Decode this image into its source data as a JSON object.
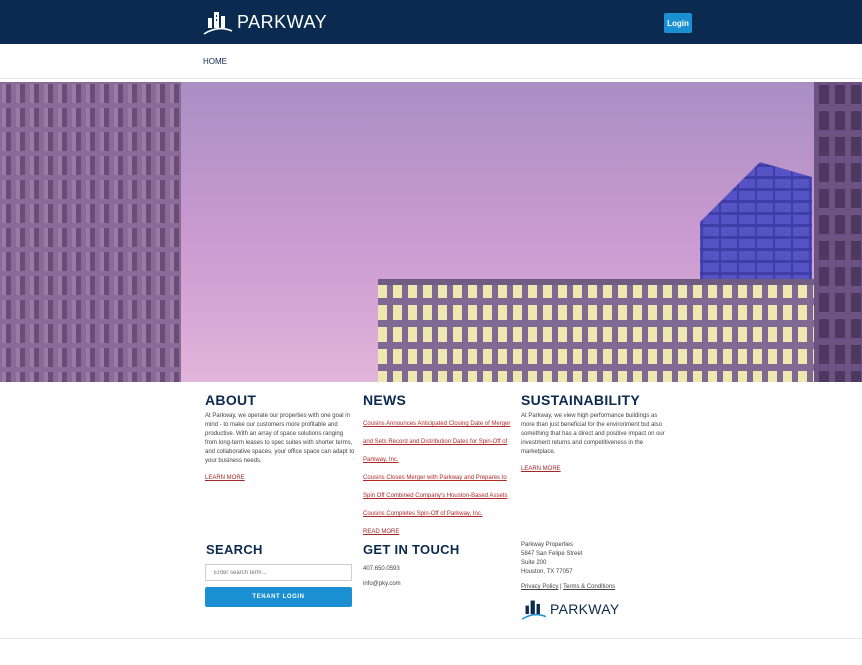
{
  "header": {
    "logo_text": "PARKWAY",
    "login_label": "Login",
    "bg_color": "#0b2a4f",
    "accent_color": "#1a8fd1"
  },
  "nav": {
    "home_label": "HOME"
  },
  "about": {
    "title": "ABOUT",
    "body": "At Parkway, we operate our properties with one goal in mind - to make our customers more profitable and productive. With an array of space solutions ranging from long-term leases to spec suites with shorter terms, and collaborative spaces, your office space can adapt to your business needs.",
    "link": "LEARN MORE"
  },
  "news": {
    "title": "NEWS",
    "items": [
      "Cousins Announces Anticipated Closing Date of Merger and Sets Record and Distribution Dates for Spin-Off of Parkway, Inc.",
      "Cousins Closes Merger with Parkway and Prepares to Spin Off Combined Company's Houston-Based Assets",
      "Cousins Completes Spin-Off of Parkway, Inc."
    ],
    "link": "READ MORE"
  },
  "sustainability": {
    "title": "SUSTAINABILITY",
    "body": "At Parkway, we view high performance buildings as more than just beneficial for the environment but also something that has a direct and positive impact on our investment returns and competitiveness in the marketplace.",
    "link": "LEARN MORE"
  },
  "search": {
    "title": "SEARCH",
    "placeholder": "Enter search term...",
    "tenant_login": "TENANT LOGIN"
  },
  "contact": {
    "title": "GET IN TOUCH",
    "phone": "407.650.0593",
    "email": "info@pky.com"
  },
  "address": {
    "line1": "Parkway Properties",
    "line2": "5847 San Felipe Street",
    "line3": "Suite 200",
    "line4": "Houston, TX 77057"
  },
  "legal": {
    "privacy": "Privacy Policy",
    "separator": "|",
    "terms": "Terms & Conditions"
  },
  "footer_logo_text": "PARKWAY"
}
